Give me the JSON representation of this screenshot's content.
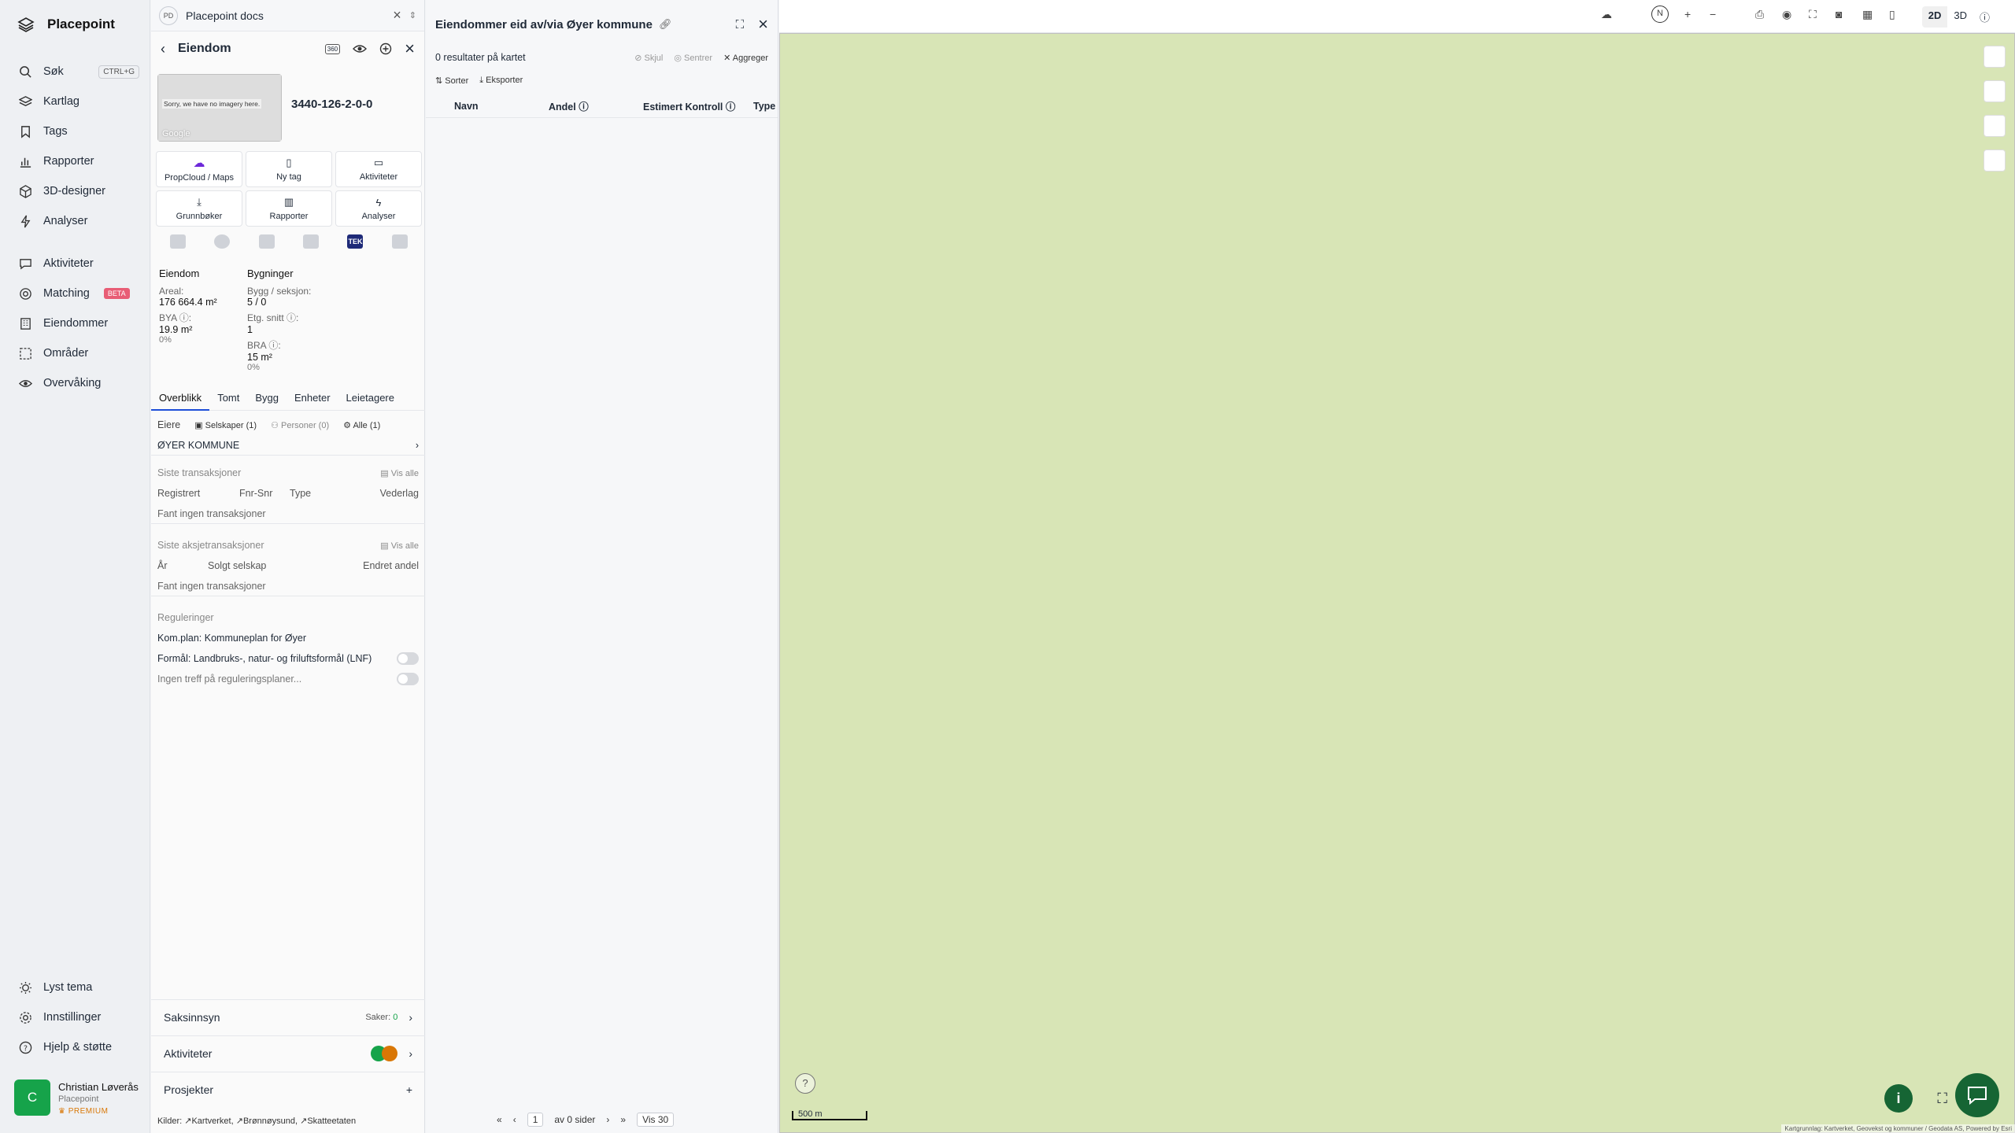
{
  "nav": {
    "brand": "Placepoint",
    "items": [
      {
        "label": "Søk",
        "kbd": "CTRL+G"
      },
      {
        "label": "Kartlag"
      },
      {
        "label": "Tags"
      },
      {
        "label": "Rapporter"
      },
      {
        "label": "3D-designer"
      },
      {
        "label": "Analyser"
      },
      {
        "label": "Aktiviteter"
      },
      {
        "label": "Matching",
        "badge": "BETA"
      },
      {
        "label": "Eiendommer"
      },
      {
        "label": "Områder"
      },
      {
        "label": "Overvåking"
      }
    ],
    "bottom": [
      {
        "label": "Lyst tema"
      },
      {
        "label": "Innstillinger"
      },
      {
        "label": "Hjelp & støtte"
      }
    ],
    "user": {
      "initial": "C",
      "name": "Christian Løverås",
      "org": "Placepoint",
      "tier": "PREMIUM"
    }
  },
  "panel1": {
    "tab_logo": "PD",
    "tab_title": "Placepoint docs",
    "title": "Eiendom",
    "badge_360": "360",
    "image_text": "Sorry, we have no imagery here.",
    "image_credit": "Google",
    "property_id": "3440-126-2-0-0",
    "actions": [
      {
        "label": "PropCloud / Maps"
      },
      {
        "label": "Ny tag"
      },
      {
        "label": "Aktiviteter"
      },
      {
        "label": "Grunnbøker"
      },
      {
        "label": "Rapporter"
      },
      {
        "label": "Analyser"
      }
    ],
    "tek": "TEK",
    "eiendom": {
      "heading": "Eiendom",
      "areal_label": "Areal:",
      "areal_value": "176 664.4",
      "areal_unit": "m²",
      "bya_label": "BYA ⓘ:",
      "bya_value": "19.9",
      "bya_unit": "m²",
      "bya_pct": "0%"
    },
    "bygninger": {
      "heading": "Bygninger",
      "bygg_label": "Bygg / seksjon:",
      "bygg_value": "5 / 0",
      "etg_label": "Etg. snitt ⓘ:",
      "etg_value": "1",
      "bra_label": "BRA ⓘ:",
      "bra_value": "15",
      "bra_unit": "m²",
      "bra_pct": "0%"
    },
    "tabs": [
      "Overblikk",
      "Tomt",
      "Bygg",
      "Enheter",
      "Leietagere"
    ],
    "owners": {
      "label": "Eiere",
      "companies": "Selskaper (1)",
      "persons": "Personer (0)",
      "all": "Alle (1)",
      "owner": "ØYER KOMMUNE"
    },
    "transactions": {
      "title": "Siste transaksjoner",
      "show_all": "Vis alle",
      "cols": [
        "Registrert",
        "Fnr-Snr",
        "Type",
        "Vederlag"
      ],
      "empty": "Fant ingen transaksjoner"
    },
    "share_tx": {
      "title": "Siste aksjetransaksjoner",
      "show_all": "Vis alle",
      "cols": [
        "År",
        "Solgt selskap",
        "Endret andel"
      ],
      "empty": "Fant ingen transaksjoner"
    },
    "reg": {
      "title": "Reguleringer",
      "plan": "Kom.plan: Kommuneplan for Øyer",
      "purpose": "Formål: Landbruks-, natur- og friluftsformål (LNF)",
      "none": "Ingen treff på reguleringsplaner..."
    },
    "sections": [
      {
        "label": "Saksinnsyn",
        "meta_label": "Saker:",
        "meta_value": "0"
      },
      {
        "label": "Aktiviteter"
      },
      {
        "label": "Prosjekter"
      }
    ],
    "sources_label": "Kilder:",
    "sources": [
      "Kartverket",
      "Brønnøysund",
      "Skatteetaten"
    ]
  },
  "panel2": {
    "title": "Eiendommer eid av/via Øyer kommune",
    "count_text": "0 resultater på kartet",
    "opt_hide": "Skjul",
    "opt_center": "Sentrer",
    "opt_aggr": "Aggreger",
    "sort": "Sorter",
    "export": "Eksporter",
    "columns": [
      "Navn",
      "Andel ⓘ",
      "Estimert Kontroll ⓘ",
      "Type"
    ],
    "pager": {
      "page": "1",
      "of": "av 0 sider",
      "per": "Vis 30"
    }
  },
  "toolbar": {
    "mode_2d": "2D",
    "mode_3d": "3D",
    "compass": "N"
  },
  "map": {
    "scale": "500 m",
    "attribution": "Kartgrunnlag: Kartverket, Geovekst og kommuner / Geodata AS, Powered by Esri",
    "colors": {
      "water": "#b6e3f4",
      "forest": "#cfe3a2",
      "field": "#f6f0a0",
      "road": "#e8553b"
    }
  }
}
